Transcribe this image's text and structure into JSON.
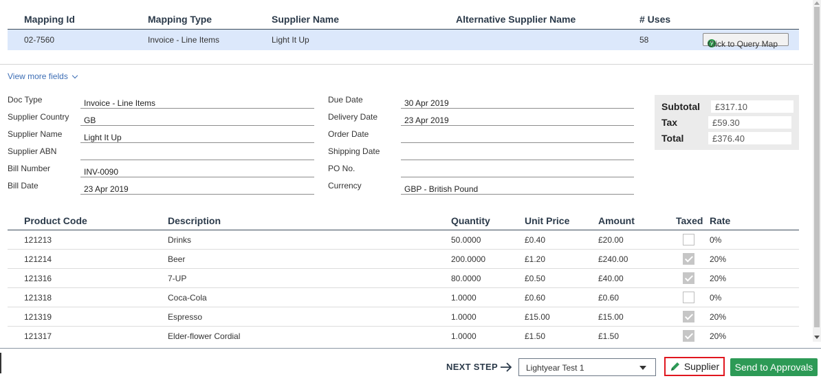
{
  "mapping": {
    "headers": [
      "Mapping Id",
      "Mapping Type",
      "Supplier Name",
      "Alternative Supplier Name",
      "# Uses"
    ],
    "row": {
      "id": "02-7560",
      "type": "Invoice - Line Items",
      "supplier_name": "Light It Up",
      "alternative_supplier_name": "",
      "uses": "58"
    },
    "query_button_label": "Click to Query Map",
    "query_icon": "help-circle-icon"
  },
  "view_more_label": "View more fields",
  "fields_left": [
    {
      "label": "Doc Type",
      "value": "Invoice - Line Items"
    },
    {
      "label": "Supplier Country",
      "value": "GB"
    },
    {
      "label": "Supplier Name",
      "value": "Light It Up"
    },
    {
      "label": "Supplier ABN",
      "value": ""
    },
    {
      "label": "Bill Number",
      "value": "INV-0090"
    },
    {
      "label": "Bill Date",
      "value": "23 Apr 2019"
    }
  ],
  "fields_right": [
    {
      "label": "Due Date",
      "value": "30 Apr 2019"
    },
    {
      "label": "Delivery Date",
      "value": "23 Apr 2019"
    },
    {
      "label": "Order Date",
      "value": ""
    },
    {
      "label": "Shipping Date",
      "value": ""
    },
    {
      "label": "PO No.",
      "value": ""
    },
    {
      "label": "Currency",
      "value": "GBP - British Pound"
    }
  ],
  "totals": {
    "subtotal_label": "Subtotal",
    "subtotal": "£317.10",
    "tax_label": "Tax",
    "tax": "£59.30",
    "total_label": "Total",
    "total": "£376.40"
  },
  "products": {
    "headers": [
      "Product Code",
      "Description",
      "Quantity",
      "Unit Price",
      "Amount",
      "Taxed",
      "Rate"
    ],
    "rows": [
      {
        "code": "121213",
        "description": "Drinks",
        "quantity": "50.0000",
        "unit_price": "£0.40",
        "amount": "£20.00",
        "taxed": false,
        "rate": "0%"
      },
      {
        "code": "121214",
        "description": "Beer",
        "quantity": "200.0000",
        "unit_price": "£1.20",
        "amount": "£240.00",
        "taxed": true,
        "rate": "20%"
      },
      {
        "code": "121316",
        "description": "7-UP",
        "quantity": "80.0000",
        "unit_price": "£0.50",
        "amount": "£40.00",
        "taxed": true,
        "rate": "20%"
      },
      {
        "code": "121318",
        "description": "Coca-Cola",
        "quantity": "1.0000",
        "unit_price": "£0.60",
        "amount": "£0.60",
        "taxed": false,
        "rate": "0%"
      },
      {
        "code": "121319",
        "description": "Espresso",
        "quantity": "1.0000",
        "unit_price": "£15.00",
        "amount": "£15.00",
        "taxed": true,
        "rate": "20%"
      },
      {
        "code": "121317",
        "description": "Elder-flower Cordial",
        "quantity": "1.0000",
        "unit_price": "£1.50",
        "amount": "£1.50",
        "taxed": true,
        "rate": "20%"
      }
    ]
  },
  "bottom": {
    "next_step_label": "NEXT STEP",
    "next_step_select": "Lightyear Test 1",
    "supplier_button": "Supplier",
    "send_button": "Send to Approvals"
  },
  "colors": {
    "accent": "#3d6eb5",
    "row_highlight": "#dce8fb",
    "send_green": "#2d9a56",
    "highlight_red": "#e0161e"
  }
}
